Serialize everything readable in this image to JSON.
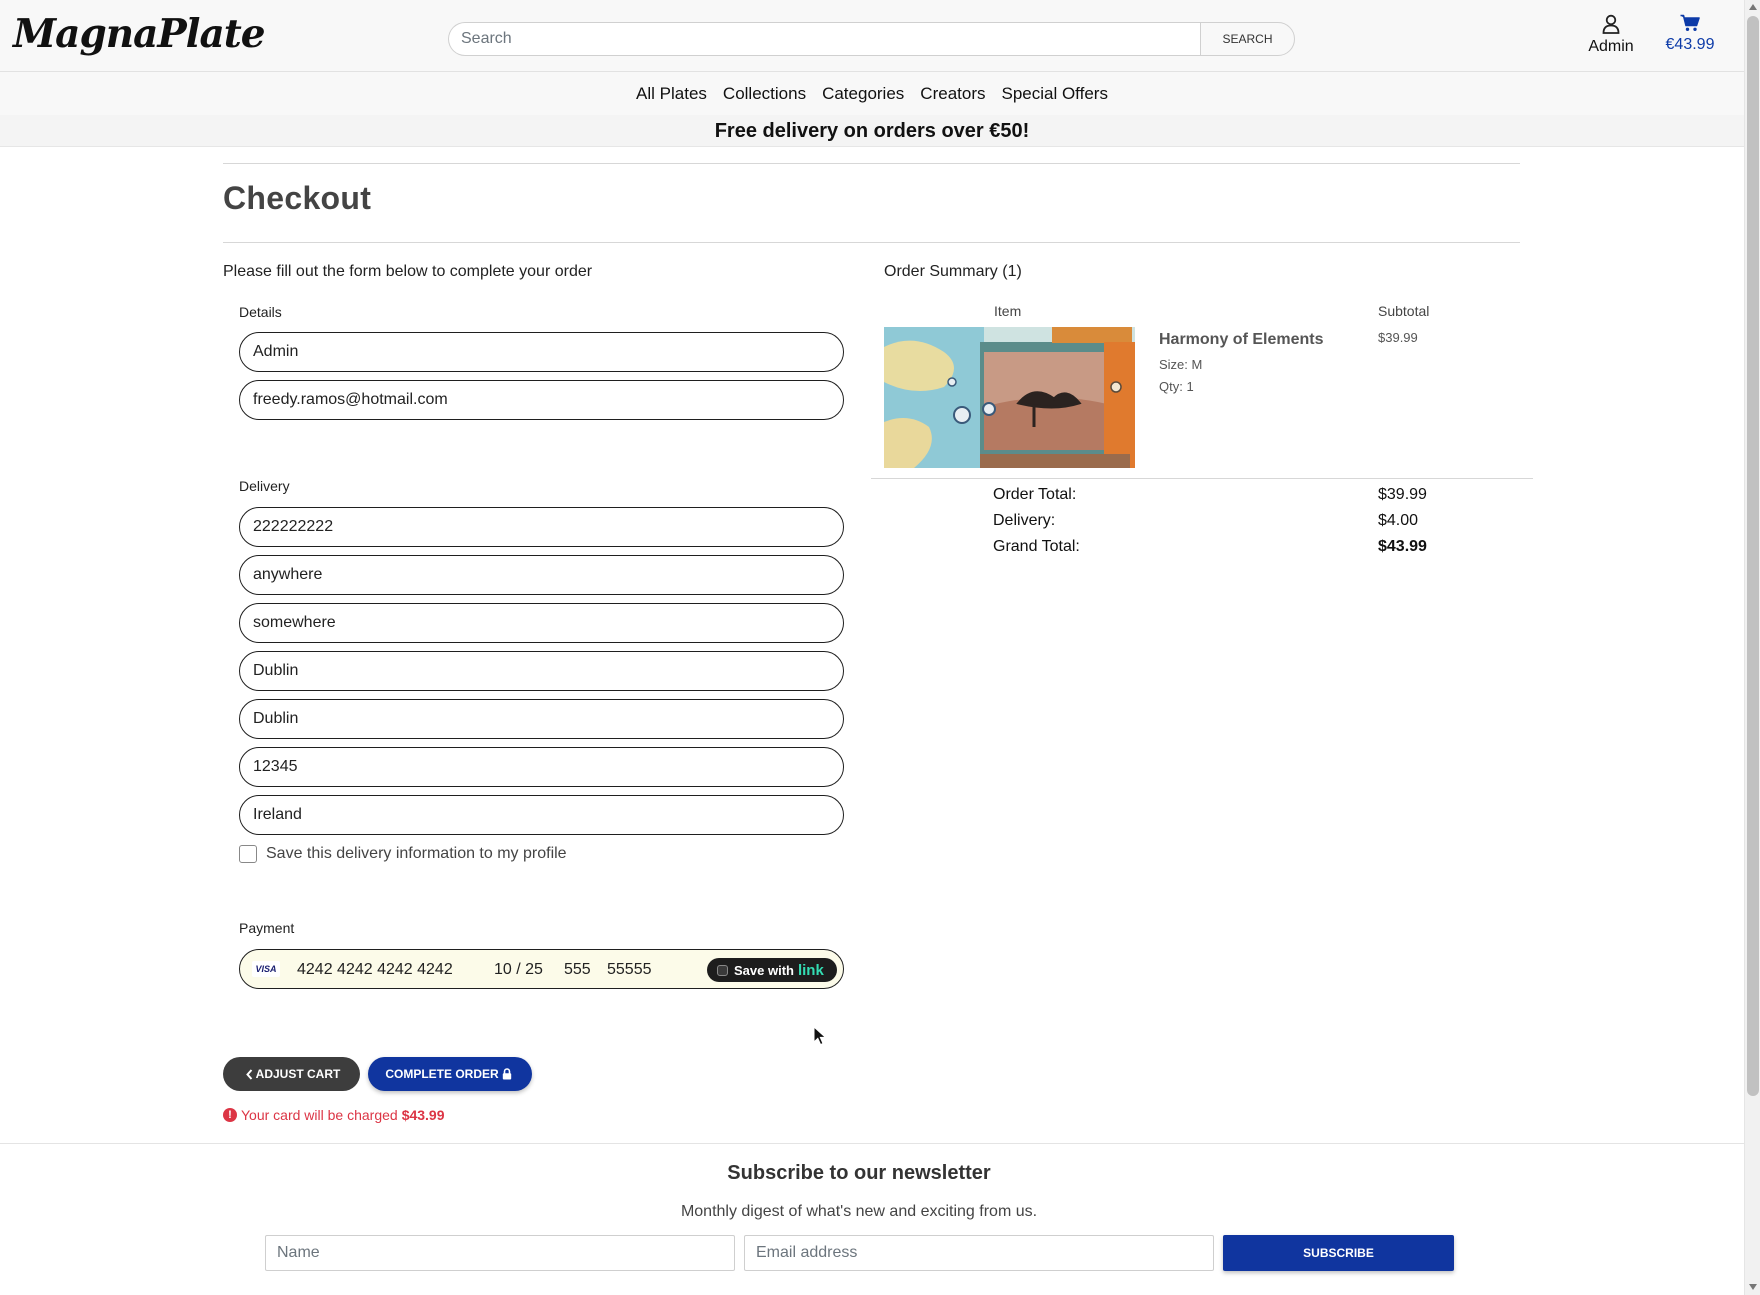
{
  "header": {
    "logo": "MagnaPlate",
    "search_placeholder": "Search",
    "search_button": "SEARCH",
    "account_label": "Admin",
    "cart_total": "€43.99"
  },
  "nav": {
    "items": [
      "All Plates",
      "Collections",
      "Categories",
      "Creators",
      "Special Offers"
    ]
  },
  "banner": "Free delivery on orders over €50!",
  "checkout": {
    "title": "Checkout",
    "intro": "Please fill out the form below to complete your order",
    "details_label": "Details",
    "details": {
      "full_name": "Admin",
      "email": "freedy.ramos@hotmail.com"
    },
    "delivery_label": "Delivery",
    "delivery": {
      "phone": "222222222",
      "street_address1": "anywhere",
      "street_address2": "somewhere",
      "town_city": "Dublin",
      "county": "Dublin",
      "postcode": "12345",
      "country": "Ireland"
    },
    "save_info_label": "Save this delivery information to my profile",
    "payment_label": "Payment",
    "payment": {
      "card_brand": "VISA",
      "card_number": "4242 4242 4242 4242",
      "expiry": "10 / 25",
      "cvc": "555",
      "zip": "55555",
      "link_save_label": "Save with",
      "link_brand": "link"
    },
    "adjust_cart_button": "ADJUST CART",
    "complete_order_button": "COMPLETE ORDER",
    "charge_note": "Your card will be charged",
    "charge_amount": "$43.99"
  },
  "summary": {
    "title": "Order Summary (1)",
    "col_item": "Item",
    "col_subtotal": "Subtotal",
    "product": {
      "name": "Harmony of Elements",
      "size": "Size: M",
      "qty": "Qty: 1",
      "price": "$39.99"
    },
    "order_total_label": "Order Total:",
    "order_total": "$39.99",
    "delivery_label": "Delivery:",
    "delivery": "$4.00",
    "grand_total_label": "Grand Total:",
    "grand_total": "$43.99"
  },
  "newsletter": {
    "title": "Subscribe to our newsletter",
    "subtitle": "Monthly digest of what's new and exciting from us.",
    "name_placeholder": "Name",
    "email_placeholder": "Email address",
    "button": "SUBSCRIBE"
  },
  "colors": {
    "primary": "#10359f",
    "dark_button": "#3d3d3d",
    "error": "#dc3545",
    "cart_accent": "#0d3ba8"
  }
}
